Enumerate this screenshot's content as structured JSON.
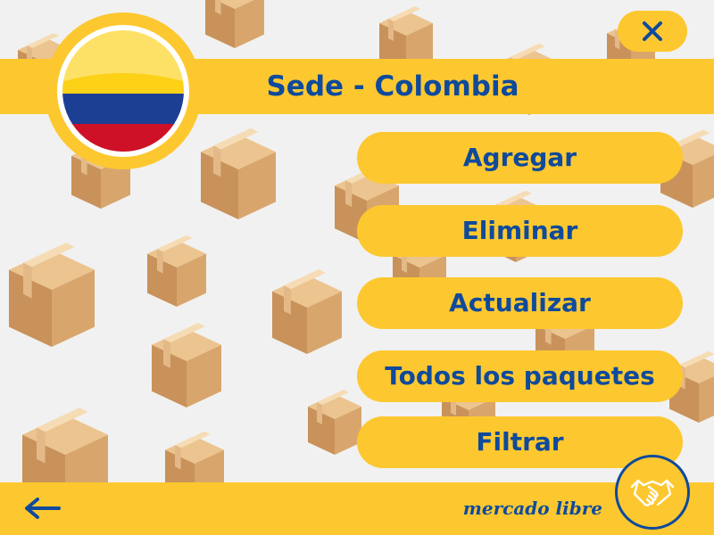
{
  "header": {
    "title": "Sede - Colombia",
    "flag_icon": "colombia-flag-icon",
    "close_icon": "close-icon"
  },
  "menu": {
    "items": [
      {
        "id": "agregar",
        "label": "Agregar"
      },
      {
        "id": "eliminar",
        "label": "Eliminar"
      },
      {
        "id": "actualizar",
        "label": "Actualizar"
      },
      {
        "id": "todos-los-paquetes",
        "label": "Todos los paquetes"
      },
      {
        "id": "filtrar",
        "label": "Filtrar"
      }
    ]
  },
  "footer": {
    "back_icon": "arrow-left-icon",
    "brand": "mercado libre",
    "logo_icon": "handshake-icon"
  },
  "colors": {
    "accent": "#fdc82f",
    "text": "#0f4a9c",
    "background": "#f1f1f1",
    "box": "#d6a46c"
  }
}
